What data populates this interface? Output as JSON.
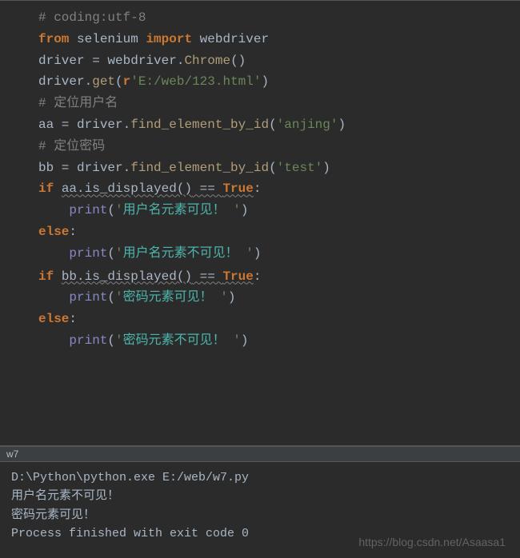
{
  "editor": {
    "l1": {
      "comment": "# coding:utf-8"
    },
    "l2": {
      "kw_from": "from",
      "mod": "selenium",
      "kw_import": "import",
      "name": "webdriver"
    },
    "l3": {
      "v": "driver",
      "eq": " = ",
      "obj": "webdriver",
      "dot": ".",
      "fn": "Chrome",
      "par": "()"
    },
    "l4": {
      "v": "driver",
      "dot": ".",
      "fn": "get",
      "open": "(",
      "pre": "r",
      "str": "'E:/web/123.html'",
      "close": ")"
    },
    "l5": {
      "comment": "# 定位用户名"
    },
    "l6": {
      "v": "aa",
      "eq": " = ",
      "obj": "driver",
      "dot": ".",
      "fn": "find_element_by_id",
      "open": "(",
      "str": "'anjing'",
      "close": ")"
    },
    "l7": {
      "comment": "# 定位密码"
    },
    "l8": {
      "v": "bb",
      "eq": " = ",
      "obj": "driver",
      "dot": ".",
      "fn": "find_element_by_id",
      "open": "(",
      "str": "'test'",
      "close": ")"
    },
    "l9": {
      "kw": "if ",
      "expr": "aa.is_displayed()",
      "eqeq": " == ",
      "true": "True",
      "colon": ":"
    },
    "l10": {
      "indent": "    ",
      "fn": "print",
      "open": "(",
      "q1": "'",
      "cn": "用户名元素可见！",
      "sp": " ",
      "q2": "'",
      "close": ")"
    },
    "l11": {
      "kw": "else",
      "colon": ":"
    },
    "l12": {
      "indent": "    ",
      "fn": "print",
      "open": "(",
      "q1": "'",
      "cn": "用户名元素不可见！",
      "sp": " ",
      "q2": "'",
      "close": ")"
    },
    "l13": {
      "blank": ""
    },
    "l14": {
      "kw": "if ",
      "expr": "bb.is_displayed()",
      "eqeq": " == ",
      "true": "True",
      "colon": ":"
    },
    "l15": {
      "indent": "    ",
      "fn": "print",
      "open": "(",
      "q1": "'",
      "cn": "密码元素可见！",
      "sp": " ",
      "q2": "'",
      "close": ")"
    },
    "l16": {
      "kw": "else",
      "colon": ":"
    },
    "l17": {
      "indent": "    ",
      "fn": "print",
      "open": "(",
      "q1": "'",
      "cn": "密码元素不可见！",
      "sp": " ",
      "q2": "'",
      "close": ")"
    }
  },
  "tab": {
    "label": "w7"
  },
  "console": {
    "l1": "D:\\Python\\python.exe E:/web/w7.py",
    "l2": "用户名元素不可见！",
    "l3": "密码元素可见！",
    "l4": "",
    "l5": "Process finished with exit code 0"
  },
  "watermark": "https://blog.csdn.net/Asaasa1"
}
